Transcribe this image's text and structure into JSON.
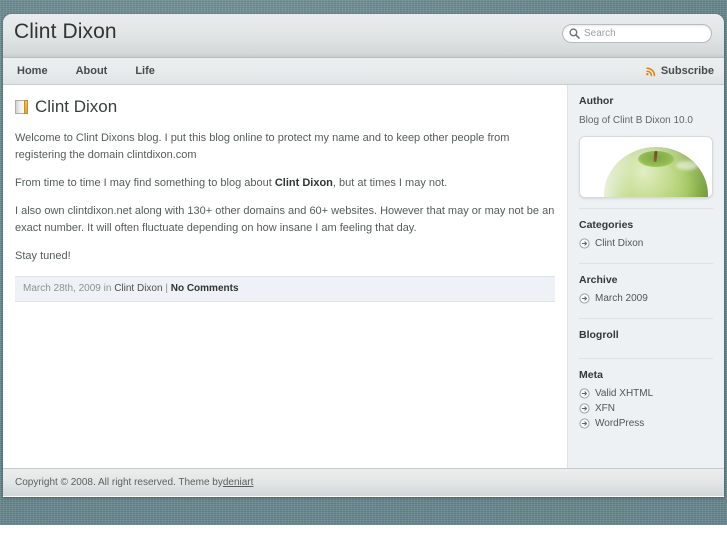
{
  "header": {
    "site_title": "Clint Dixon",
    "search": {
      "placeholder": "Search",
      "value": "",
      "icon": "search-icon"
    }
  },
  "nav": {
    "items": [
      {
        "label": "Home"
      },
      {
        "label": "About"
      },
      {
        "label": "Life"
      }
    ],
    "subscribe": {
      "label": "Subscribe",
      "icon": "rss-icon",
      "color": "#e8820c"
    }
  },
  "post": {
    "icon": "book-icon",
    "title": "Clint Dixon",
    "paragraphs": [
      "Welcome to Clint Dixons blog. I put this blog online to protect my name and to keep other people from registering the domain clintdixon.com",
      "I also own clintdixon.net along with 130+ other domains and 60+ websites. However that may or may not be an exact number. It will often fluctuate depending on how insane I am feeling that day.",
      "Stay tuned!"
    ],
    "para2": {
      "before": "From time to time I may find something to blog about ",
      "bold": "Clint Dixon",
      "after": ",  but at times I may not."
    },
    "meta": {
      "date": "March 28th, 2009",
      "in_word": "in",
      "category": "Clint Dixon",
      "separator": "|",
      "comments": "No Comments"
    }
  },
  "sidebar": {
    "widgets": [
      {
        "title": "Author",
        "description": "Blog of Clint B Dixon 10.0",
        "image": "green-apple-photo",
        "items": []
      },
      {
        "title": "Categories",
        "description": "",
        "items": [
          {
            "label": "Clint Dixon"
          }
        ]
      },
      {
        "title": "Archive",
        "description": "",
        "items": [
          {
            "label": "March 2009"
          }
        ]
      },
      {
        "title": "Blogroll",
        "description": "",
        "items": []
      },
      {
        "title": "Meta",
        "description": "",
        "items": [
          {
            "label": "Valid XHTML"
          },
          {
            "label": "XFN"
          },
          {
            "label": "WordPress"
          }
        ]
      }
    ]
  },
  "footer": {
    "text": "Copyright © 2008. All right reserved. Theme by ",
    "link_label": "deniart"
  },
  "theme": {
    "backdrop": "#6d8e95",
    "sidebar_bg": "#eef1f4",
    "accent_orange": "#e8820c"
  }
}
